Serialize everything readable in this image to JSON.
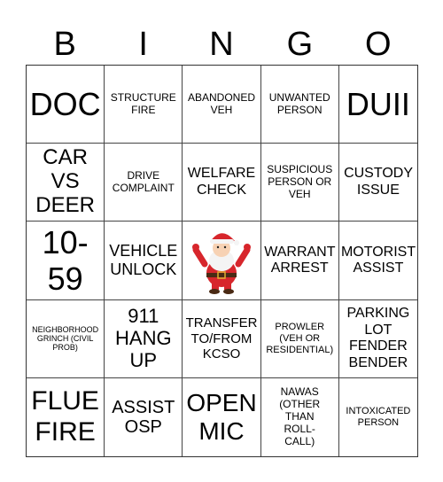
{
  "header": [
    "B",
    "I",
    "N",
    "G",
    "O"
  ],
  "cells": [
    "DOC",
    "STRUCTURE FIRE",
    "ABANDONED VEH",
    "UNWANTED PERSON",
    "DUII",
    "CAR VS DEER",
    "DRIVE COMPLAINT",
    "WELFARE CHECK",
    "SUSPICIOUS PERSON OR VEH",
    "CUSTODY ISSUE",
    "10-59",
    "VEHICLE UNLOCK",
    "",
    "WARRANT ARREST",
    "MOTORIST ASSIST",
    "NEIGHBORHOOD GRINCH (CIVIL PROB)",
    "911 HANG UP",
    "TRANSFER TO/FROM KCSO",
    "PROWLER (VEH OR RESIDENTIAL)",
    "PARKING LOT FENDER BENDER",
    "FLUE FIRE",
    "ASSIST OSP",
    "OPEN MIC",
    "NAWAS (OTHER THAN ROLL-CALL)",
    "INTOXICATED PERSON"
  ],
  "free_space": {
    "icon": "santa-claus-icon"
  }
}
